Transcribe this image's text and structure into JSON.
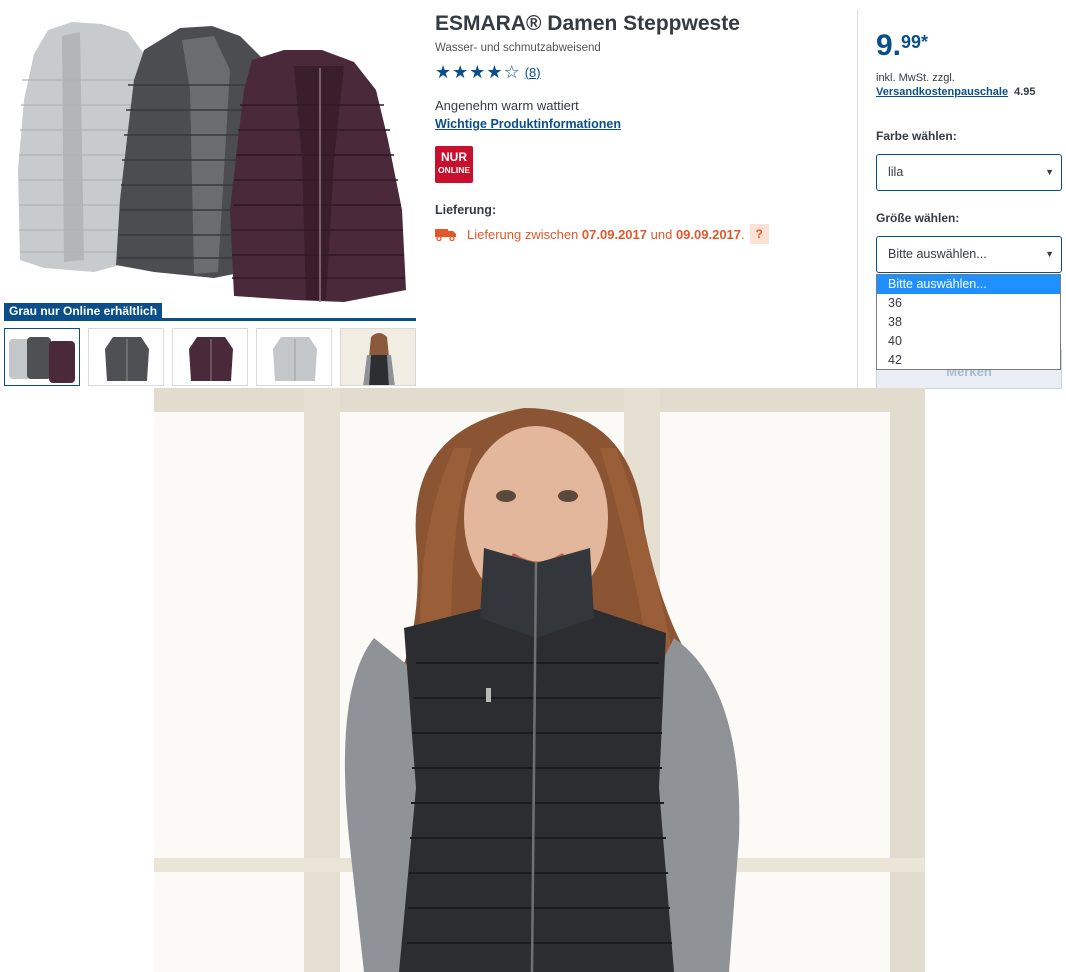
{
  "product": {
    "title": "ESMARA® Damen Steppweste",
    "subtitle": "Wasser- und schmutzabweisend",
    "rating_value": 4,
    "rating_max": 5,
    "review_count": "(8)",
    "description": "Angenehm warm wattiert",
    "info_link": "Wichtige Produktinformationen",
    "badge_line1": "NUR",
    "badge_line2": "ONLINE"
  },
  "gallery": {
    "promo_label": "Grau nur Online erhältlich",
    "thumbnails": [
      "all-vests-thumbnail",
      "grey-vest-thumbnail",
      "purple-vest-thumbnail",
      "light-grey-vest-thumbnail",
      "model-photo-thumbnail"
    ],
    "active_thumbnail": 0
  },
  "delivery": {
    "label": "Lieferung:",
    "text_prefix": "Lieferung zwischen",
    "date_from": "07.09.2017",
    "text_and": "und",
    "date_to": "09.09.2017",
    "text_suffix": ".",
    "help": "?"
  },
  "pricing": {
    "price_main": "9.",
    "price_cents": "99*",
    "tax_note": "inkl. MwSt. zzgl.",
    "shipping_link": "Versandkostenpauschale",
    "shipping_cost": "4.95"
  },
  "color_select": {
    "label": "Farbe wählen:",
    "value": "lila"
  },
  "size_select": {
    "label": "Größe wählen:",
    "value": "Bitte auswählen...",
    "options": [
      "Bitte auswählen...",
      "36",
      "38",
      "40",
      "42"
    ],
    "highlighted_index": 0
  },
  "actions": {
    "merken": "Merken"
  },
  "colors": {
    "brand_blue": "#0a4f8a",
    "badge_red": "#c8102e",
    "delivery_orange": "#e2582a",
    "option_highlight": "#1e90ff"
  }
}
